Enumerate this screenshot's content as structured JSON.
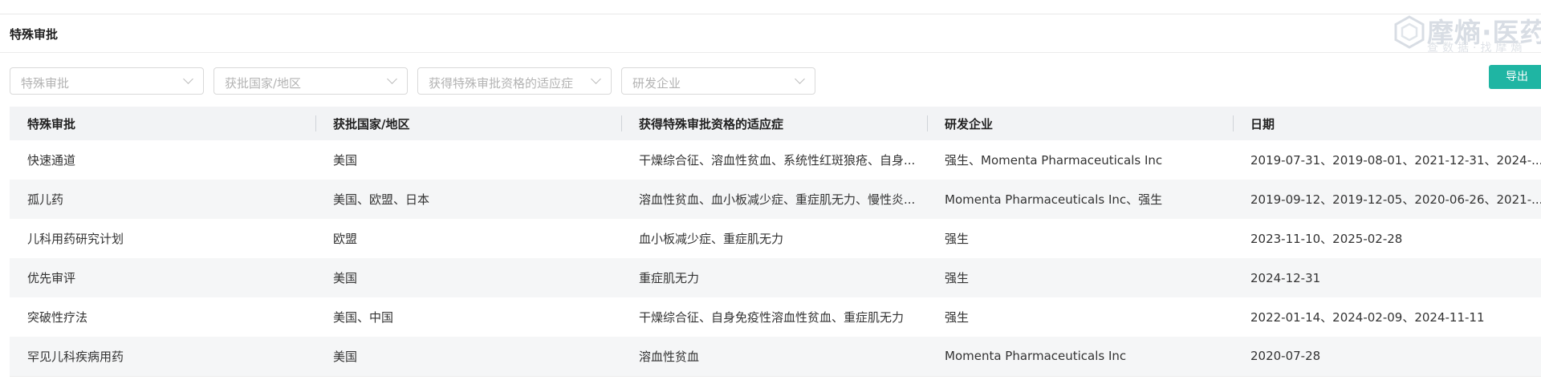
{
  "section": {
    "title": "特殊审批"
  },
  "watermark": {
    "brand": "摩熵·医药",
    "tagline": "查数据·找摩熵"
  },
  "filters": [
    {
      "placeholder": "特殊审批"
    },
    {
      "placeholder": "获批国家/地区"
    },
    {
      "placeholder": "获得特殊审批资格的适应症"
    },
    {
      "placeholder": "研发企业"
    }
  ],
  "toolbar": {
    "export_label": "导出"
  },
  "table": {
    "columns": [
      "特殊审批",
      "获批国家/地区",
      "获得特殊审批资格的适应症",
      "研发企业",
      "日期"
    ],
    "rows": [
      [
        "快速通道",
        "美国",
        "干燥综合征、溶血性贫血、系统性红斑狼疮、自身...",
        "强生、Momenta Pharmaceuticals Inc",
        "2019-07-31、2019-08-01、2021-12-31、2024-..."
      ],
      [
        "孤儿药",
        "美国、欧盟、日本",
        "溶血性贫血、血小板减少症、重症肌无力、慢性炎...",
        "Momenta Pharmaceuticals Inc、强生",
        "2019-09-12、2019-12-05、2020-06-26、2021-..."
      ],
      [
        "儿科用药研究计划",
        "欧盟",
        "血小板减少症、重症肌无力",
        "强生",
        "2023-11-10、2025-02-28"
      ],
      [
        "优先审评",
        "美国",
        "重症肌无力",
        "强生",
        "2024-12-31"
      ],
      [
        "突破性疗法",
        "美国、中国",
        "干燥综合征、自身免疫性溶血性贫血、重症肌无力",
        "强生",
        "2022-01-14、2024-02-09、2024-11-11"
      ],
      [
        "罕见儿科疾病用药",
        "美国",
        "溶血性贫血",
        "Momenta Pharmaceuticals Inc",
        "2020-07-28"
      ]
    ]
  }
}
